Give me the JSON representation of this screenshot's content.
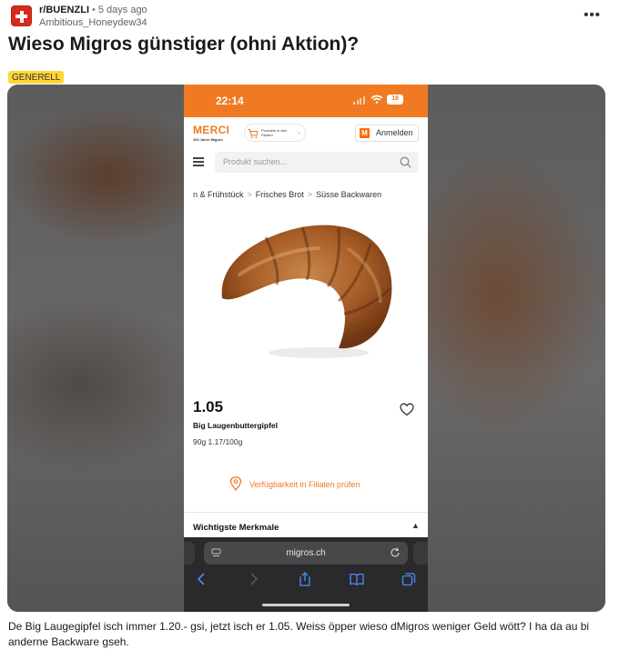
{
  "post": {
    "subreddit": "r/BUENZLI",
    "dot": "•",
    "time": "5 days ago",
    "author": "Ambitious_Honeydew34",
    "title": "Wieso Migros günstiger (ohni Aktion)?",
    "flair": "GENERELL",
    "more": "•••",
    "body": "De Big Laugegipfel isch immer 1.20.- gsi, jetzt isch er 1.05. Weiss öpper wieso dMigros weniger Geld wött? I ha da au bi anderne Backware gseh."
  },
  "phone": {
    "status_time": "22:14",
    "battery": "18",
    "logo": "MERCI",
    "logo_sub": "100 Jahre Migros",
    "store_selector": "Produkte in den Filialen",
    "login_badge": "M",
    "login_label": "Anmelden",
    "search_placeholder": "Produkt suchen...",
    "breadcrumb": [
      "n & Frühstück",
      "Frisches Brot",
      "Süsse Backwaren"
    ],
    "breadcrumb_sep": ">",
    "price": "1.05",
    "product_name": "Big Laugenbuttergipfel",
    "product_qty": "90g   1.17/100g",
    "availability_label": "Verfügbarkeit in Filialen prüfen",
    "features_label": "Wichtigste Merkmale",
    "features_chevron": "▲",
    "url": "migros.ch"
  },
  "colors": {
    "migros_orange": "#ef7a22",
    "flair_yellow": "#ffd635",
    "subreddit_icon": "#d52b1e"
  }
}
